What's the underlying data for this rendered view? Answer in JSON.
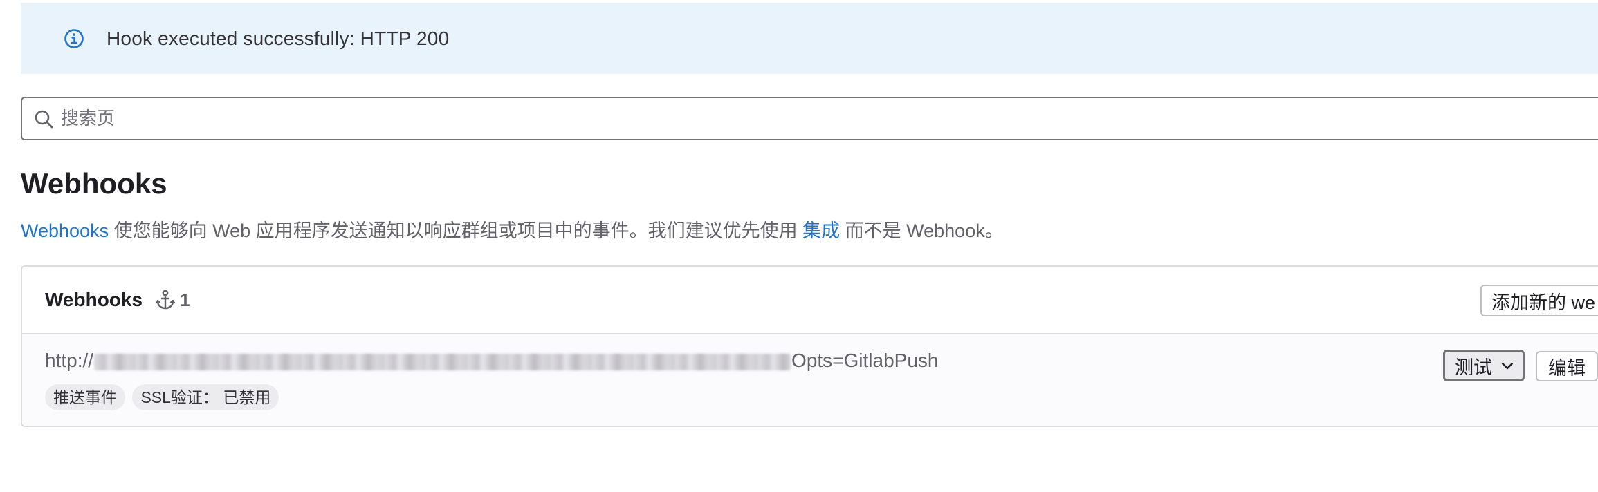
{
  "alert": {
    "icon": "info-icon",
    "message": "Hook executed successfully: HTTP 200",
    "color": "#1f75cb",
    "background": "#e9f3fc"
  },
  "search": {
    "icon": "search-icon",
    "placeholder": "搜索页",
    "value": ""
  },
  "page": {
    "title": "Webhooks",
    "description": {
      "link1": "Webhooks",
      "text1": " 使您能够向 Web 应用程序发送通知以响应群组或项目中的事件。我们建议优先使用 ",
      "link2": "集成",
      "text2": " 而不是 Webhook。"
    }
  },
  "webhooks_card": {
    "title": "Webhooks",
    "count_icon": "anchor-icon",
    "count": "1",
    "add_button": "添加新的 we",
    "hooks": [
      {
        "url_prefix": "http://",
        "url_suffix": "Opts=GitlabPush",
        "badges": [
          "推送事件",
          "SSL验证： 已禁用"
        ],
        "test_button": "测试",
        "test_icon": "chevron-down-icon",
        "edit_button": "编辑"
      }
    ]
  },
  "colors": {
    "link": "#1f75cb",
    "border": "#dcdcde",
    "badge_bg": "#ececef"
  }
}
